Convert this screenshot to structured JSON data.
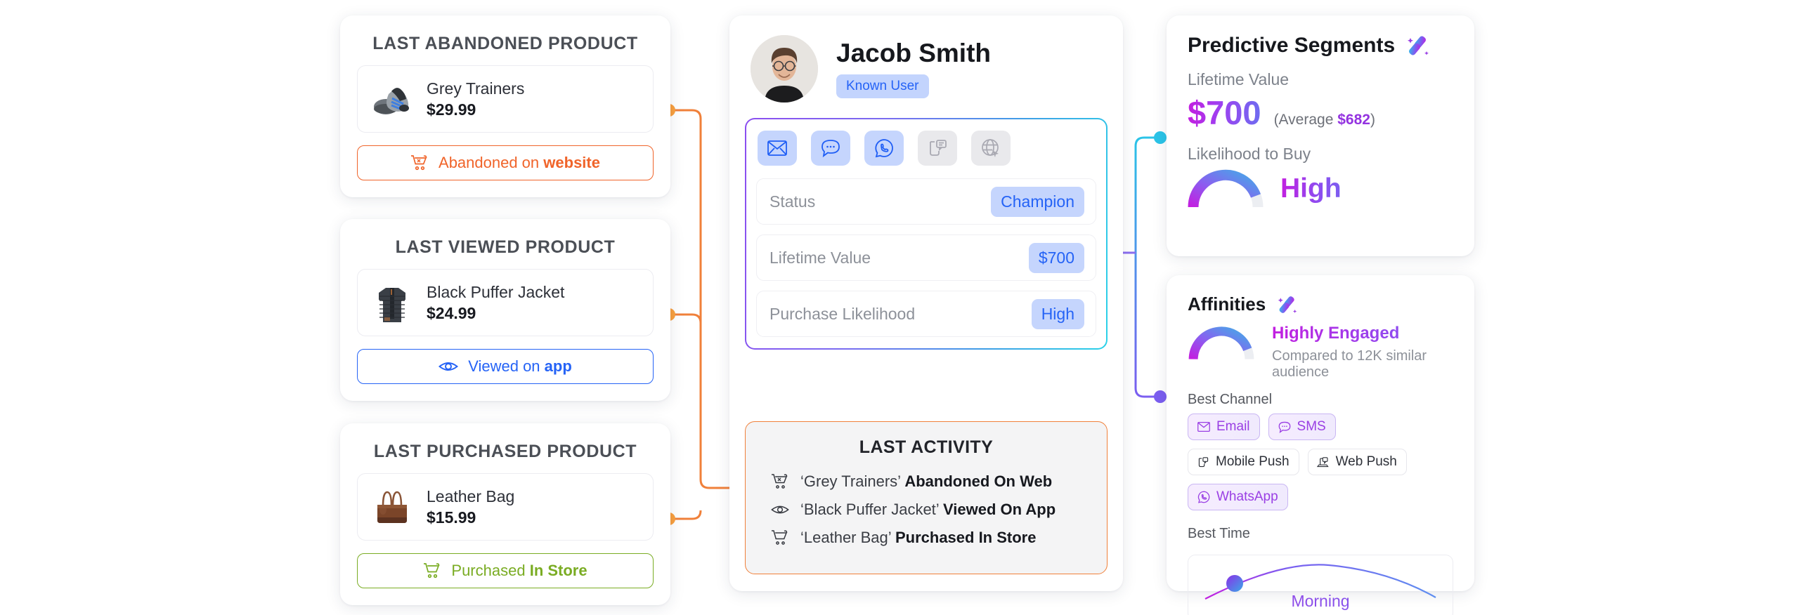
{
  "products": [
    {
      "title": "LAST ABANDONED PRODUCT",
      "name": "Grey Trainers",
      "price": "$29.99",
      "image": "grey-trainers-thumbnail",
      "action_prefix": "Abandoned on",
      "action_strong": "website",
      "action_icon": "cart-x-icon",
      "accent": "#f0642a"
    },
    {
      "title": "LAST VIEWED PRODUCT",
      "name": "Black Puffer Jacket",
      "price": "$24.99",
      "image": "black-puffer-jacket-thumbnail",
      "action_prefix": "Viewed on",
      "action_strong": "app",
      "action_icon": "eye-icon",
      "accent": "#2563f6"
    },
    {
      "title": "LAST PURCHASED PRODUCT",
      "name": "Leather Bag",
      "price": "$15.99",
      "image": "leather-bag-thumbnail",
      "action_prefix": "Purchased",
      "action_strong": "In Store",
      "action_icon": "cart-icon",
      "accent": "#7aac23"
    }
  ],
  "profile": {
    "name": "Jacob Smith",
    "badge": "Known User",
    "avatar": "user-avatar-photo",
    "channels": [
      {
        "name": "email",
        "icon": "email-icon",
        "active": true
      },
      {
        "name": "sms",
        "icon": "sms-chat-icon",
        "active": true
      },
      {
        "name": "whatsapp",
        "icon": "whatsapp-icon",
        "active": true
      },
      {
        "name": "mobile-push",
        "icon": "mobile-push-icon",
        "active": false
      },
      {
        "name": "web-push",
        "icon": "web-push-icon",
        "active": false
      }
    ],
    "rows": [
      {
        "label": "Status",
        "value": "Champion"
      },
      {
        "label": "Lifetime Value",
        "value": "$700"
      },
      {
        "label": "Purchase Likelihood",
        "value": "High"
      }
    ]
  },
  "activity": {
    "title": "LAST ACTIVITY",
    "items": [
      {
        "icon": "cart-x-icon",
        "product": "‘Grey Trainers’",
        "event": "Abandoned On Web"
      },
      {
        "icon": "eye-icon",
        "product": "‘Black Puffer Jacket’",
        "event": "Viewed On App"
      },
      {
        "icon": "cart-icon",
        "product": "‘Leather Bag’",
        "event": "Purchased In Store"
      }
    ]
  },
  "predictive": {
    "title": "Predictive Segments",
    "ai_icon": "ai-sparkle-icon",
    "ltv_label": "Lifetime Value",
    "ltv_value": "$700",
    "ltv_average_prefix": "(Average ",
    "ltv_average_value": "$682",
    "ltv_average_suffix": ")",
    "likelihood_label": "Likelihood to Buy",
    "likelihood_value": "High",
    "gauge_fill_percent": 80
  },
  "affinities": {
    "title": "Affinities",
    "ai_icon": "ai-sparkle-icon",
    "engagement": "Highly Engaged",
    "engagement_sub": "Compared to 12K similar audience",
    "gauge_fill_percent": 80,
    "best_channel_label": "Best Channel",
    "channels": [
      {
        "label": "Email",
        "icon": "email-icon",
        "active": true
      },
      {
        "label": "SMS",
        "icon": "sms-chat-icon",
        "active": true
      },
      {
        "label": "Mobile Push",
        "icon": "mobile-push-icon",
        "active": false
      },
      {
        "label": "Web Push",
        "icon": "web-push-icon",
        "active": false
      },
      {
        "label": "WhatsApp",
        "icon": "whatsapp-icon",
        "active": true
      }
    ],
    "best_time_label": "Best Time",
    "best_time_value": "Morning"
  },
  "colors": {
    "orange": "#f0803a",
    "blue": "#2563f6",
    "green": "#7aac23",
    "purple": "#7b5ef0",
    "cyan": "#2bc4e8",
    "magenta": "#c21fe0"
  }
}
